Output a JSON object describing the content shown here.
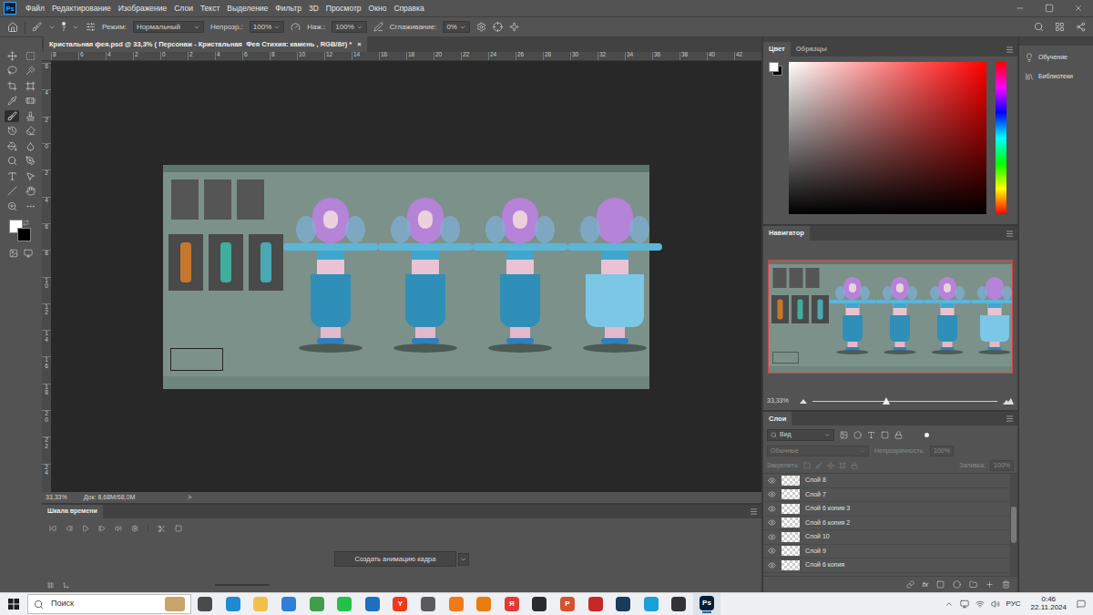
{
  "app": {
    "logo": "Ps"
  },
  "menu": [
    "Файл",
    "Редактирование",
    "Изображение",
    "Слои",
    "Текст",
    "Выделение",
    "Фильтр",
    "3D",
    "Просмотр",
    "Окно",
    "Справка"
  ],
  "options_bar": {
    "brush_size": "7",
    "mode_label": "Режим:",
    "mode": "Нормальный",
    "opacity_label": "Непрозр.:",
    "opacity": "100%",
    "flow_label": "Наж.:",
    "flow": "100%",
    "smoothing_label": "Сглаживание:",
    "smoothing": "0%"
  },
  "toolbar": {
    "tools": [
      {
        "selected": false
      },
      {
        "selected": false
      },
      {
        "selected": false
      },
      {
        "selected": false
      },
      {
        "selected": false
      },
      {
        "selected": false
      },
      {
        "selected": false
      },
      {
        "selected": false
      },
      {
        "selected": true
      },
      {
        "selected": false
      },
      {
        "selected": false
      },
      {
        "selected": false
      },
      {
        "selected": false
      },
      {
        "selected": false
      },
      {
        "selected": false
      },
      {
        "selected": false
      },
      {
        "selected": false
      },
      {
        "selected": false
      },
      {
        "selected": false
      },
      {
        "selected": false
      },
      {
        "selected": false
      },
      {
        "selected": false
      }
    ]
  },
  "document": {
    "tab_title": "Кристальная фея.psd @ 33,3% ( Персонаж - Кристальная  Фея Стихия: камень , RGB/8#) *",
    "close": "×",
    "ruler_top": [
      "8",
      "6",
      "4",
      "2",
      "0",
      "2",
      "4",
      "6",
      "8",
      "10",
      "12",
      "14",
      "16",
      "18",
      "20",
      "22",
      "24",
      "26",
      "28",
      "30",
      "32",
      "34",
      "36",
      "38",
      "40",
      "42"
    ],
    "ruler_left": [
      "6",
      "4",
      "2",
      "0",
      "2",
      "4",
      "6",
      "8",
      "10",
      "12",
      "14",
      "16",
      "18",
      "20",
      "22",
      "24"
    ],
    "zoom": "33,33%",
    "doc_info": "Док: 8,68M/68,0M",
    "info_arrow": ">"
  },
  "timeline": {
    "title": "Шкала времени",
    "create_button": "Создать анимацию кадра"
  },
  "color_panel": {
    "tabs": [
      {
        "label": "Цвет",
        "selected": true
      },
      {
        "label": "Образцы",
        "selected": false
      }
    ]
  },
  "side_panel": {
    "items": [
      "Обучение",
      "Библиотеки"
    ]
  },
  "navigator": {
    "title": "Навигатор",
    "zoom": "33,33%",
    "level": 0.4
  },
  "layers_panel": {
    "title": "Слои",
    "filter": "Вид",
    "blend_mode": "Обычные",
    "opacity_label": "Непрозрачность:",
    "opacity": "100%",
    "lock_label": "Закрепить:",
    "fill_label": "Заливка:",
    "fill": "100%",
    "options_disabled": true,
    "layers": [
      {
        "name": "Слой 8",
        "visible": true
      },
      {
        "name": "Слой 7",
        "visible": true
      },
      {
        "name": "Слой 6 копия 3",
        "visible": true
      },
      {
        "name": "Слой 6 копия 2",
        "visible": true
      },
      {
        "name": "Слой 10",
        "visible": true
      },
      {
        "name": "Слой 9",
        "visible": true
      },
      {
        "name": "Слой 6 копия",
        "visible": true
      }
    ],
    "footer_fx": "fx"
  },
  "taskbar": {
    "search": "Поиск",
    "apps": [
      {
        "glyph": "",
        "color": "#4a4a4a",
        "selected": false
      },
      {
        "glyph": "",
        "color": "#1f8ad2",
        "selected": false
      },
      {
        "glyph": "",
        "color": "#f2c04a",
        "selected": false
      },
      {
        "glyph": "",
        "color": "#2f7fd6",
        "selected": false
      },
      {
        "glyph": "",
        "color": "#3f9e4a",
        "selected": false
      },
      {
        "glyph": "",
        "color": "#25c04a",
        "selected": false
      },
      {
        "glyph": "",
        "color": "#1e6fc2",
        "selected": false
      },
      {
        "glyph": "Y",
        "color": "#f03a17",
        "selected": false
      },
      {
        "glyph": "",
        "color": "#5a5a5a",
        "selected": false
      },
      {
        "glyph": "",
        "color": "#f07a1a",
        "selected": false
      },
      {
        "glyph": "",
        "color": "#e87d0d",
        "selected": false
      },
      {
        "glyph": "Я",
        "color": "#e53935",
        "selected": false
      },
      {
        "glyph": "",
        "color": "#2b2b2b",
        "selected": false
      },
      {
        "glyph": "P",
        "color": "#d35230",
        "selected": false
      },
      {
        "glyph": "",
        "color": "#c62828",
        "selected": false
      },
      {
        "glyph": "",
        "color": "#1a3a5c",
        "selected": false
      },
      {
        "glyph": "",
        "color": "#1aa0d8",
        "selected": false
      },
      {
        "glyph": "",
        "color": "#333333",
        "selected": false
      },
      {
        "glyph": "Ps",
        "color": "#001e36",
        "selected": true
      }
    ],
    "language": "РУС",
    "time": "0:46",
    "date": "22.11.2024"
  }
}
